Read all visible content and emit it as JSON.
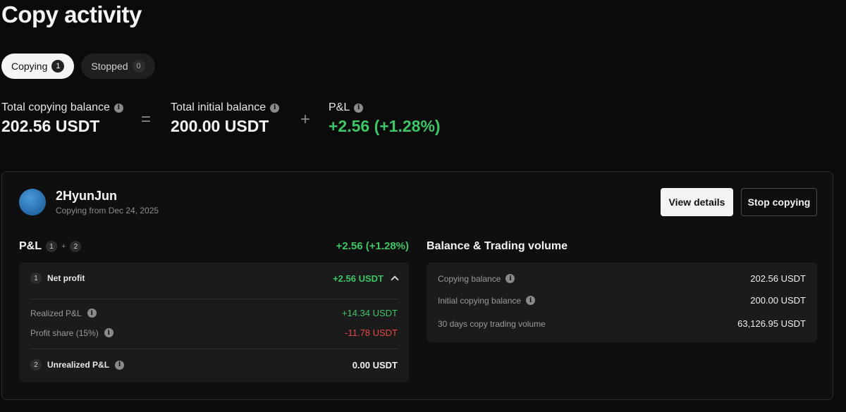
{
  "page": {
    "title": "Copy activity"
  },
  "tabs": [
    {
      "label": "Copying",
      "count": "1"
    },
    {
      "label": "Stopped",
      "count": "0"
    }
  ],
  "summary": {
    "total_copying_balance_label": "Total copying balance",
    "total_copying_balance_value": "202.56 USDT",
    "equals": "=",
    "total_initial_balance_label": "Total initial balance",
    "total_initial_balance_value": "200.00 USDT",
    "plus": "+",
    "pnl_label": "P&L",
    "pnl_value": "+2.56 (+1.28%)"
  },
  "trader": {
    "name": "2HyunJun",
    "subtitle": "Copying from Dec 24, 2025",
    "view_details_label": "View details",
    "stop_copying_label": "Stop copying"
  },
  "pnl": {
    "title": "P&L",
    "badge1": "1",
    "plus": "+",
    "badge2": "2",
    "total": "+2.56 (+1.28%)",
    "net_profit": {
      "index": "1",
      "label": "Net profit",
      "value": "+2.56 USDT"
    },
    "realized": {
      "label": "Realized P&L",
      "value": "+14.34 USDT"
    },
    "profit_share": {
      "label": "Profit share (15%)",
      "value": "-11.78 USDT"
    },
    "unrealized": {
      "index": "2",
      "label": "Unrealized P&L",
      "value": "0.00 USDT"
    }
  },
  "balance": {
    "title": "Balance & Trading volume",
    "rows": [
      {
        "label": "Copying balance",
        "value": "202.56 USDT"
      },
      {
        "label": "Initial copying balance",
        "value": "200.00 USDT"
      },
      {
        "label": "30 days copy trading volume",
        "value": "63,126.95 USDT"
      }
    ]
  },
  "colors": {
    "positive": "#3dc566",
    "negative": "#e84545",
    "background": "#0b0b0b"
  },
  "icons": {
    "info": "info-icon",
    "collapse": "chevron-up-icon"
  }
}
